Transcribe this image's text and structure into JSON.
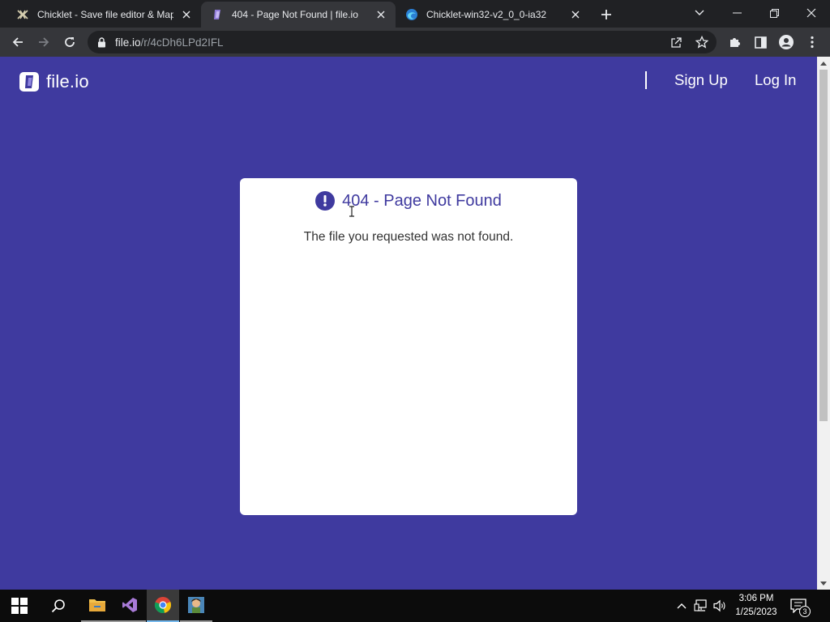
{
  "browser": {
    "tabs": [
      {
        "title": "Chicklet - Save file editor & Map",
        "active": false,
        "icon": "chicklet-favicon"
      },
      {
        "title": "404 - Page Not Found | file.io",
        "active": true,
        "icon": "fileio-favicon"
      },
      {
        "title": "Chicklet-win32-v2_0_0-ia32",
        "active": false,
        "icon": "edge-favicon"
      }
    ],
    "address": {
      "host": "file.io",
      "path": "/r/4cDh6LPd2IFL"
    }
  },
  "page": {
    "logo_text": "file.io",
    "nav": {
      "signup": "Sign Up",
      "login": "Log In"
    },
    "error": {
      "title": "404 - Page Not Found",
      "message": "The file you requested was not found."
    }
  },
  "taskbar": {
    "time": "3:06 PM",
    "date": "1/25/2023",
    "notifications": "3"
  },
  "colors": {
    "page_background": "#3f3a9f",
    "card_background": "#ffffff",
    "title_color": "#3f3a9f",
    "chrome_dark": "#202124",
    "chrome_toolbar": "#35363a"
  }
}
